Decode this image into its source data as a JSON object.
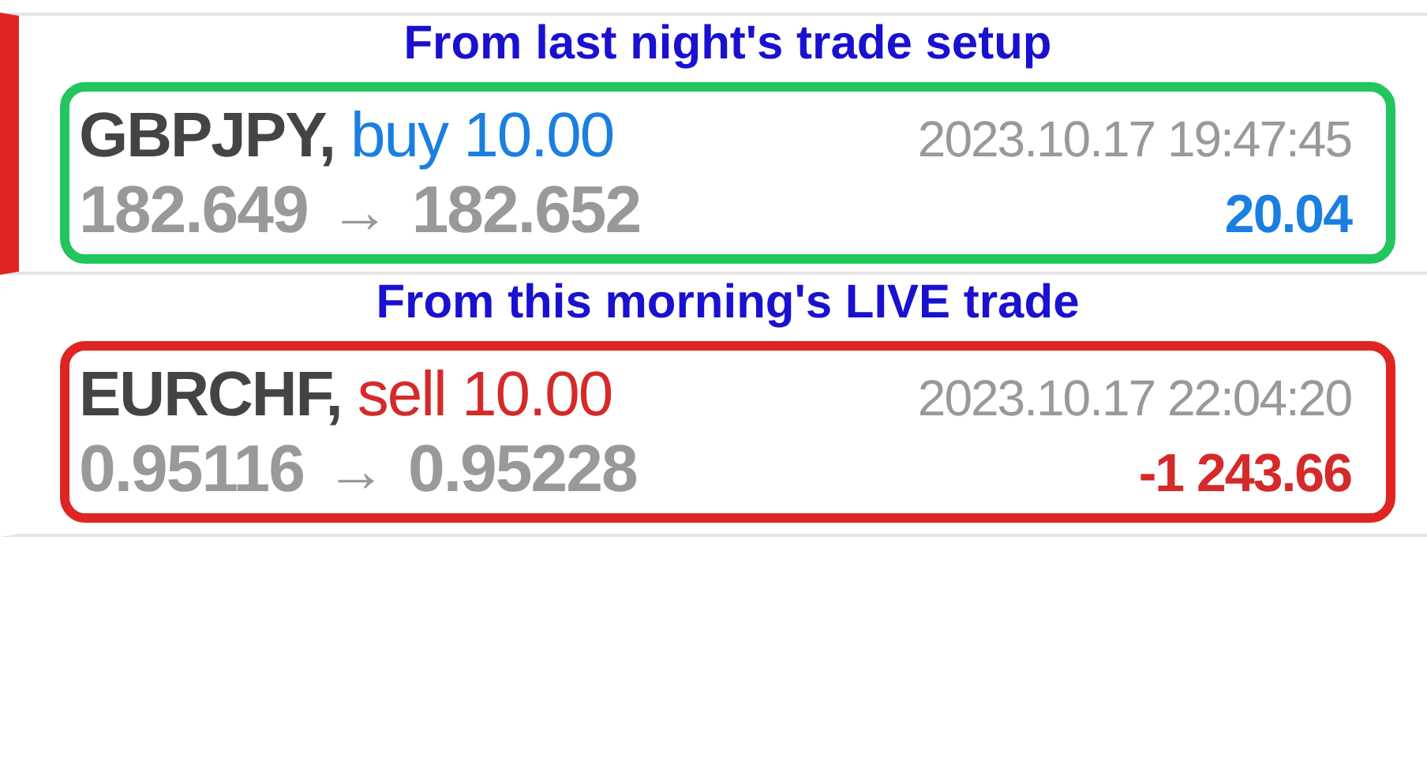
{
  "trades": [
    {
      "caption": "From last night's trade setup",
      "color": "#22c55e",
      "selected": true,
      "symbol": "GBPJPY,",
      "kind": "buy",
      "side_volume": "buy 10.00",
      "time": "2023.10.17 19:47:45",
      "open_price": "182.649",
      "arrow": "→",
      "close_price": "182.652",
      "profit": "20.04"
    },
    {
      "caption": "From this morning's LIVE trade",
      "color": "#e02424",
      "selected": false,
      "symbol": "EURCHF,",
      "kind": "sell",
      "side_volume": "sell 10.00",
      "time": "2023.10.17 22:04:20",
      "open_price": "0.95116",
      "arrow": "→",
      "close_price": "0.95228",
      "profit": "-1 243.66"
    }
  ]
}
